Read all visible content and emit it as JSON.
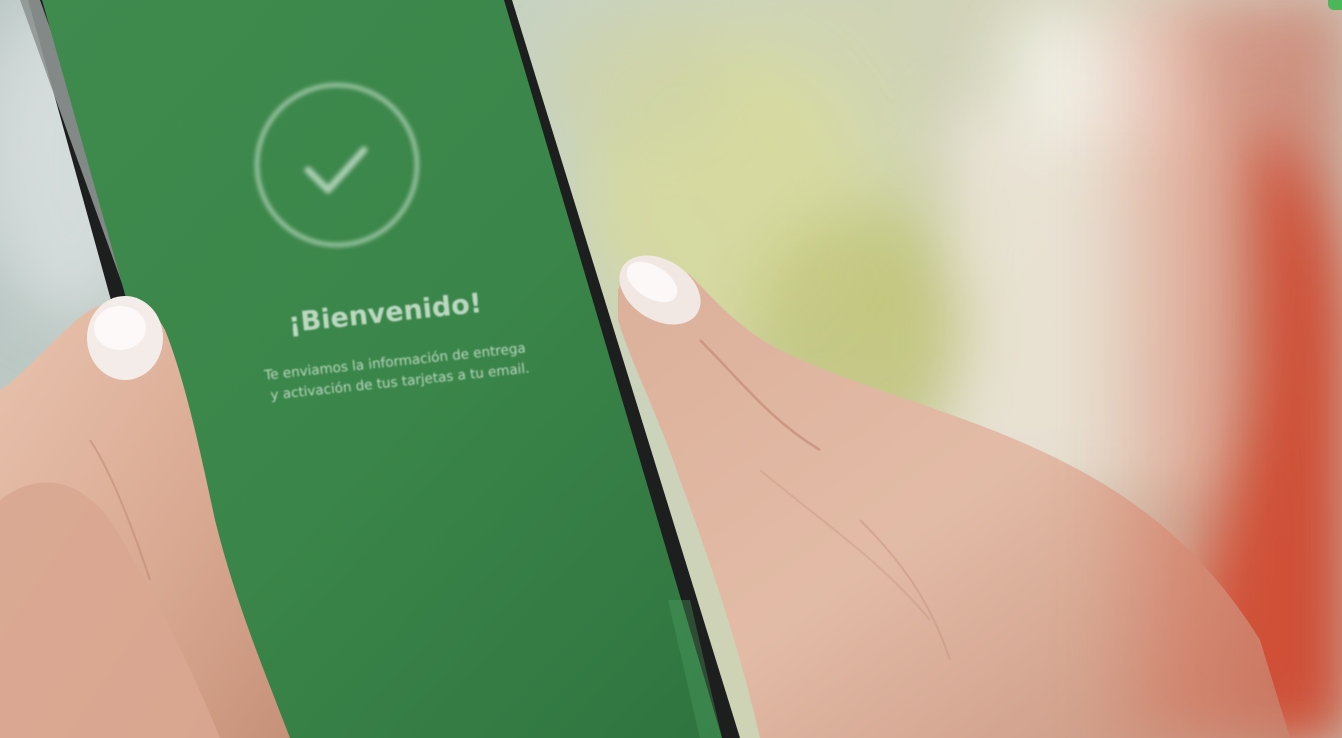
{
  "phone_screen": {
    "icon": "checkmark-circle-icon",
    "title": "¡Bienvenido!",
    "message_line1": "Te enviamos la información de entrega",
    "message_line2": "y activación de tus tarjetas a tu email."
  },
  "colors": {
    "screen_green": "#3d8a4c",
    "screen_text": "#dfeee2",
    "accent_orange": "#d2543b"
  }
}
